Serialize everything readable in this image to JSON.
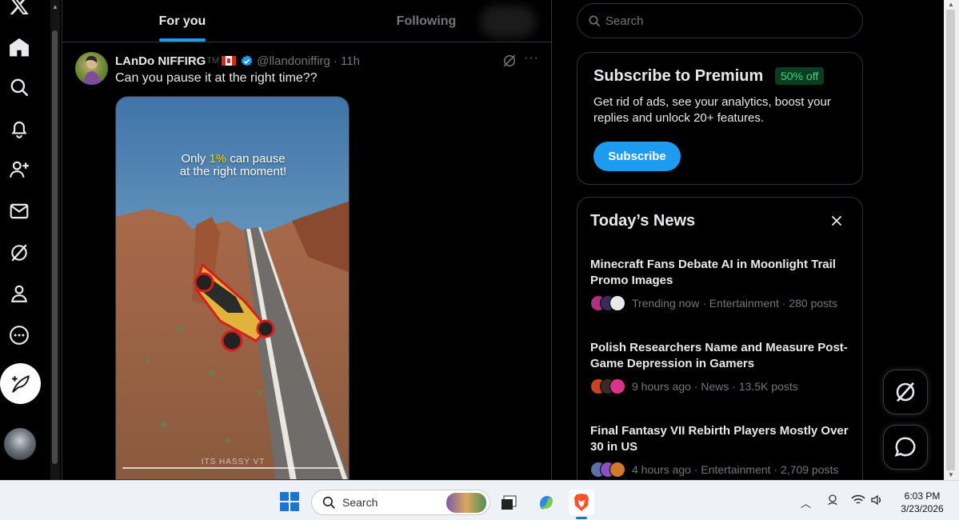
{
  "nav": {
    "icons": [
      "x-logo-icon",
      "home-icon",
      "explore-icon",
      "notifications-icon",
      "follow-icon",
      "messages-icon",
      "grok-icon",
      "profile-icon",
      "more-icon",
      "compose-icon"
    ]
  },
  "tabs": {
    "for_you": "For you",
    "following": "Following"
  },
  "tweet": {
    "name": "LAnDo NIFFIRG",
    "tm": "TM",
    "handle": "@llandoniffirg",
    "time": "· 11h",
    "text": "Can you pause it at the right time??",
    "caption_line1_a": "Only ",
    "caption_highlight": "1%",
    "caption_line1_b": " can pause",
    "caption_line2": "at the right moment!",
    "watermark": "ITS HASSY VT"
  },
  "search": {
    "placeholder": "Search"
  },
  "premium": {
    "title": "Subscribe to Premium",
    "badge": "50% off",
    "description": "Get rid of ads, see your analytics, boost your replies and unlock 20+ features.",
    "button": "Subscribe"
  },
  "news": {
    "title": "Today’s News",
    "items": [
      {
        "headline": "Minecraft Fans Debate AI in Moonlight Trail Promo Images",
        "meta": "Trending now · Entertainment · 280 posts"
      },
      {
        "headline": "Polish Researchers Name and Measure Post-Game Depression in Gamers",
        "meta": "9 hours ago · News · 13.5K posts"
      },
      {
        "headline": "Final Fantasy VII Rebirth Players Mostly Over 30 in US",
        "meta": "4 hours ago · Entertainment · 2,709 posts"
      }
    ]
  },
  "taskbar": {
    "search": "Search",
    "time": "6:03 PM",
    "date": "3/23/2026"
  },
  "colors": {
    "accent": "#1d9bf0",
    "badge_bg": "#0b3d22",
    "badge_text": "#3ed47c",
    "brave": "#fb542b"
  }
}
